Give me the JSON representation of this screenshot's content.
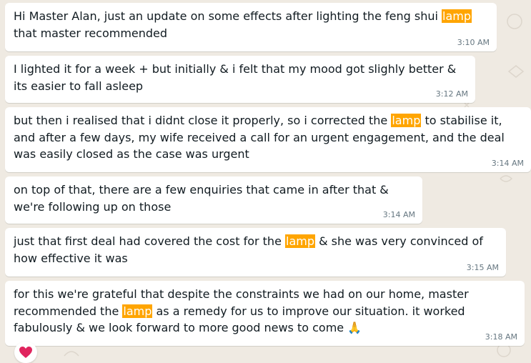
{
  "messages": [
    {
      "parts": [
        "Hi Master Alan, just an update on some effects after lighting the feng shui ",
        "lamp",
        " that master recommended"
      ],
      "time": "3:10 AM"
    },
    {
      "parts": [
        "I lighted it for a week + but initially & i felt that my mood got slighly better & its easier to fall asleep",
        "",
        ""
      ],
      "time": "3:12 AM"
    },
    {
      "parts": [
        "but then i realised that i didnt close it properly, so i corrected the ",
        "lamp",
        " to stabilise it, and after a few days, my wife received a call for an urgent engagement, and the deal was easily closed as the case was urgent"
      ],
      "time": "3:14 AM"
    },
    {
      "parts": [
        "on top of that, there are a few enquiries that came in after that & we're following up on those",
        "",
        ""
      ],
      "time": "3:14 AM"
    },
    {
      "parts": [
        "just that first deal had covered the cost for the ",
        "lamp",
        " & she was very convinced of how effective it was"
      ],
      "time": "3:15 AM"
    },
    {
      "parts": [
        "for this we're grateful that despite the constraints we had on our home, master recommended the ",
        "lamp",
        " as a remedy for us to improve our situation. it worked fabulously & we look forward to more good news to come 🙏"
      ],
      "time": "3:18 AM"
    }
  ],
  "reaction": {
    "icon": "red-heart-icon",
    "color": "#e0245e"
  },
  "colors": {
    "highlight": "#ffa500",
    "background": "#efeae2",
    "bubble": "#ffffff",
    "timestamp": "#667781"
  }
}
